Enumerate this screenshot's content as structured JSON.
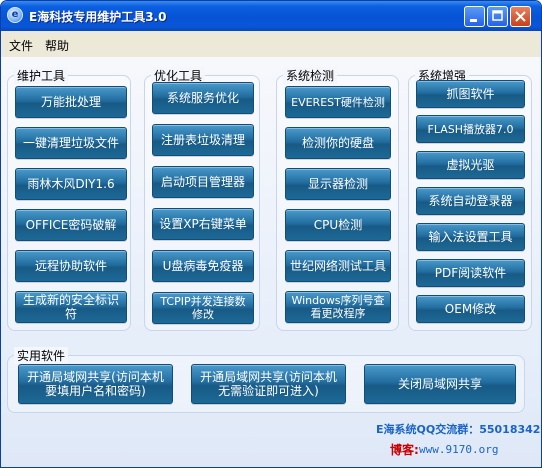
{
  "window": {
    "title": "E海科技专用维护工具3.0",
    "app_icon_glyph": "e"
  },
  "menu": [
    "文件",
    "帮助"
  ],
  "groups": {
    "maintenance": {
      "title": "维护工具",
      "buttons": [
        "万能批处理",
        "一键清理垃圾文件",
        "雨林木风DIY1.6",
        "OFFICE密码破解",
        "远程协助软件",
        "生成新的安全标识符"
      ]
    },
    "optimize": {
      "title": "优化工具",
      "buttons": [
        "系统服务优化",
        "注册表垃圾清理",
        "启动项目管理器",
        "设置XP右键菜单",
        "U盘病毒免疫器",
        "TCPIP并发连接数修改"
      ]
    },
    "detect": {
      "title": "系统检测",
      "buttons": [
        "EVEREST硬件检测",
        "检测你的硬盘",
        "显示器检测",
        "CPU检测",
        "世纪网络测试工具",
        "Windows序列号查看更改程序"
      ]
    },
    "enhance": {
      "title": "系统增强",
      "buttons": [
        "抓图软件",
        "FLASH播放器7.0",
        "虚拟光驱",
        "系统自动登录器",
        "输入法设置工具",
        "PDF阅读软件",
        "OEM修改"
      ]
    },
    "utility": {
      "title": "实用软件",
      "buttons": [
        "开通局域网共享(访问本机要填用户名和密码)",
        "开通局域网共享(访问本机无需验证即可进入)",
        "关闭局域网共享"
      ]
    }
  },
  "footer": {
    "qq_group": "E海系统QQ交流群：55018342",
    "blog_label": "博客:",
    "blog_url": "www.9170.org"
  },
  "colors": {
    "titlebar": "#0753d6",
    "button": "#226d9f",
    "footer_text": "#1a64c8",
    "blog_label": "#cc0000"
  },
  "icons": [
    "minimize-icon",
    "maximize-icon",
    "close-icon",
    "app-icon"
  ]
}
